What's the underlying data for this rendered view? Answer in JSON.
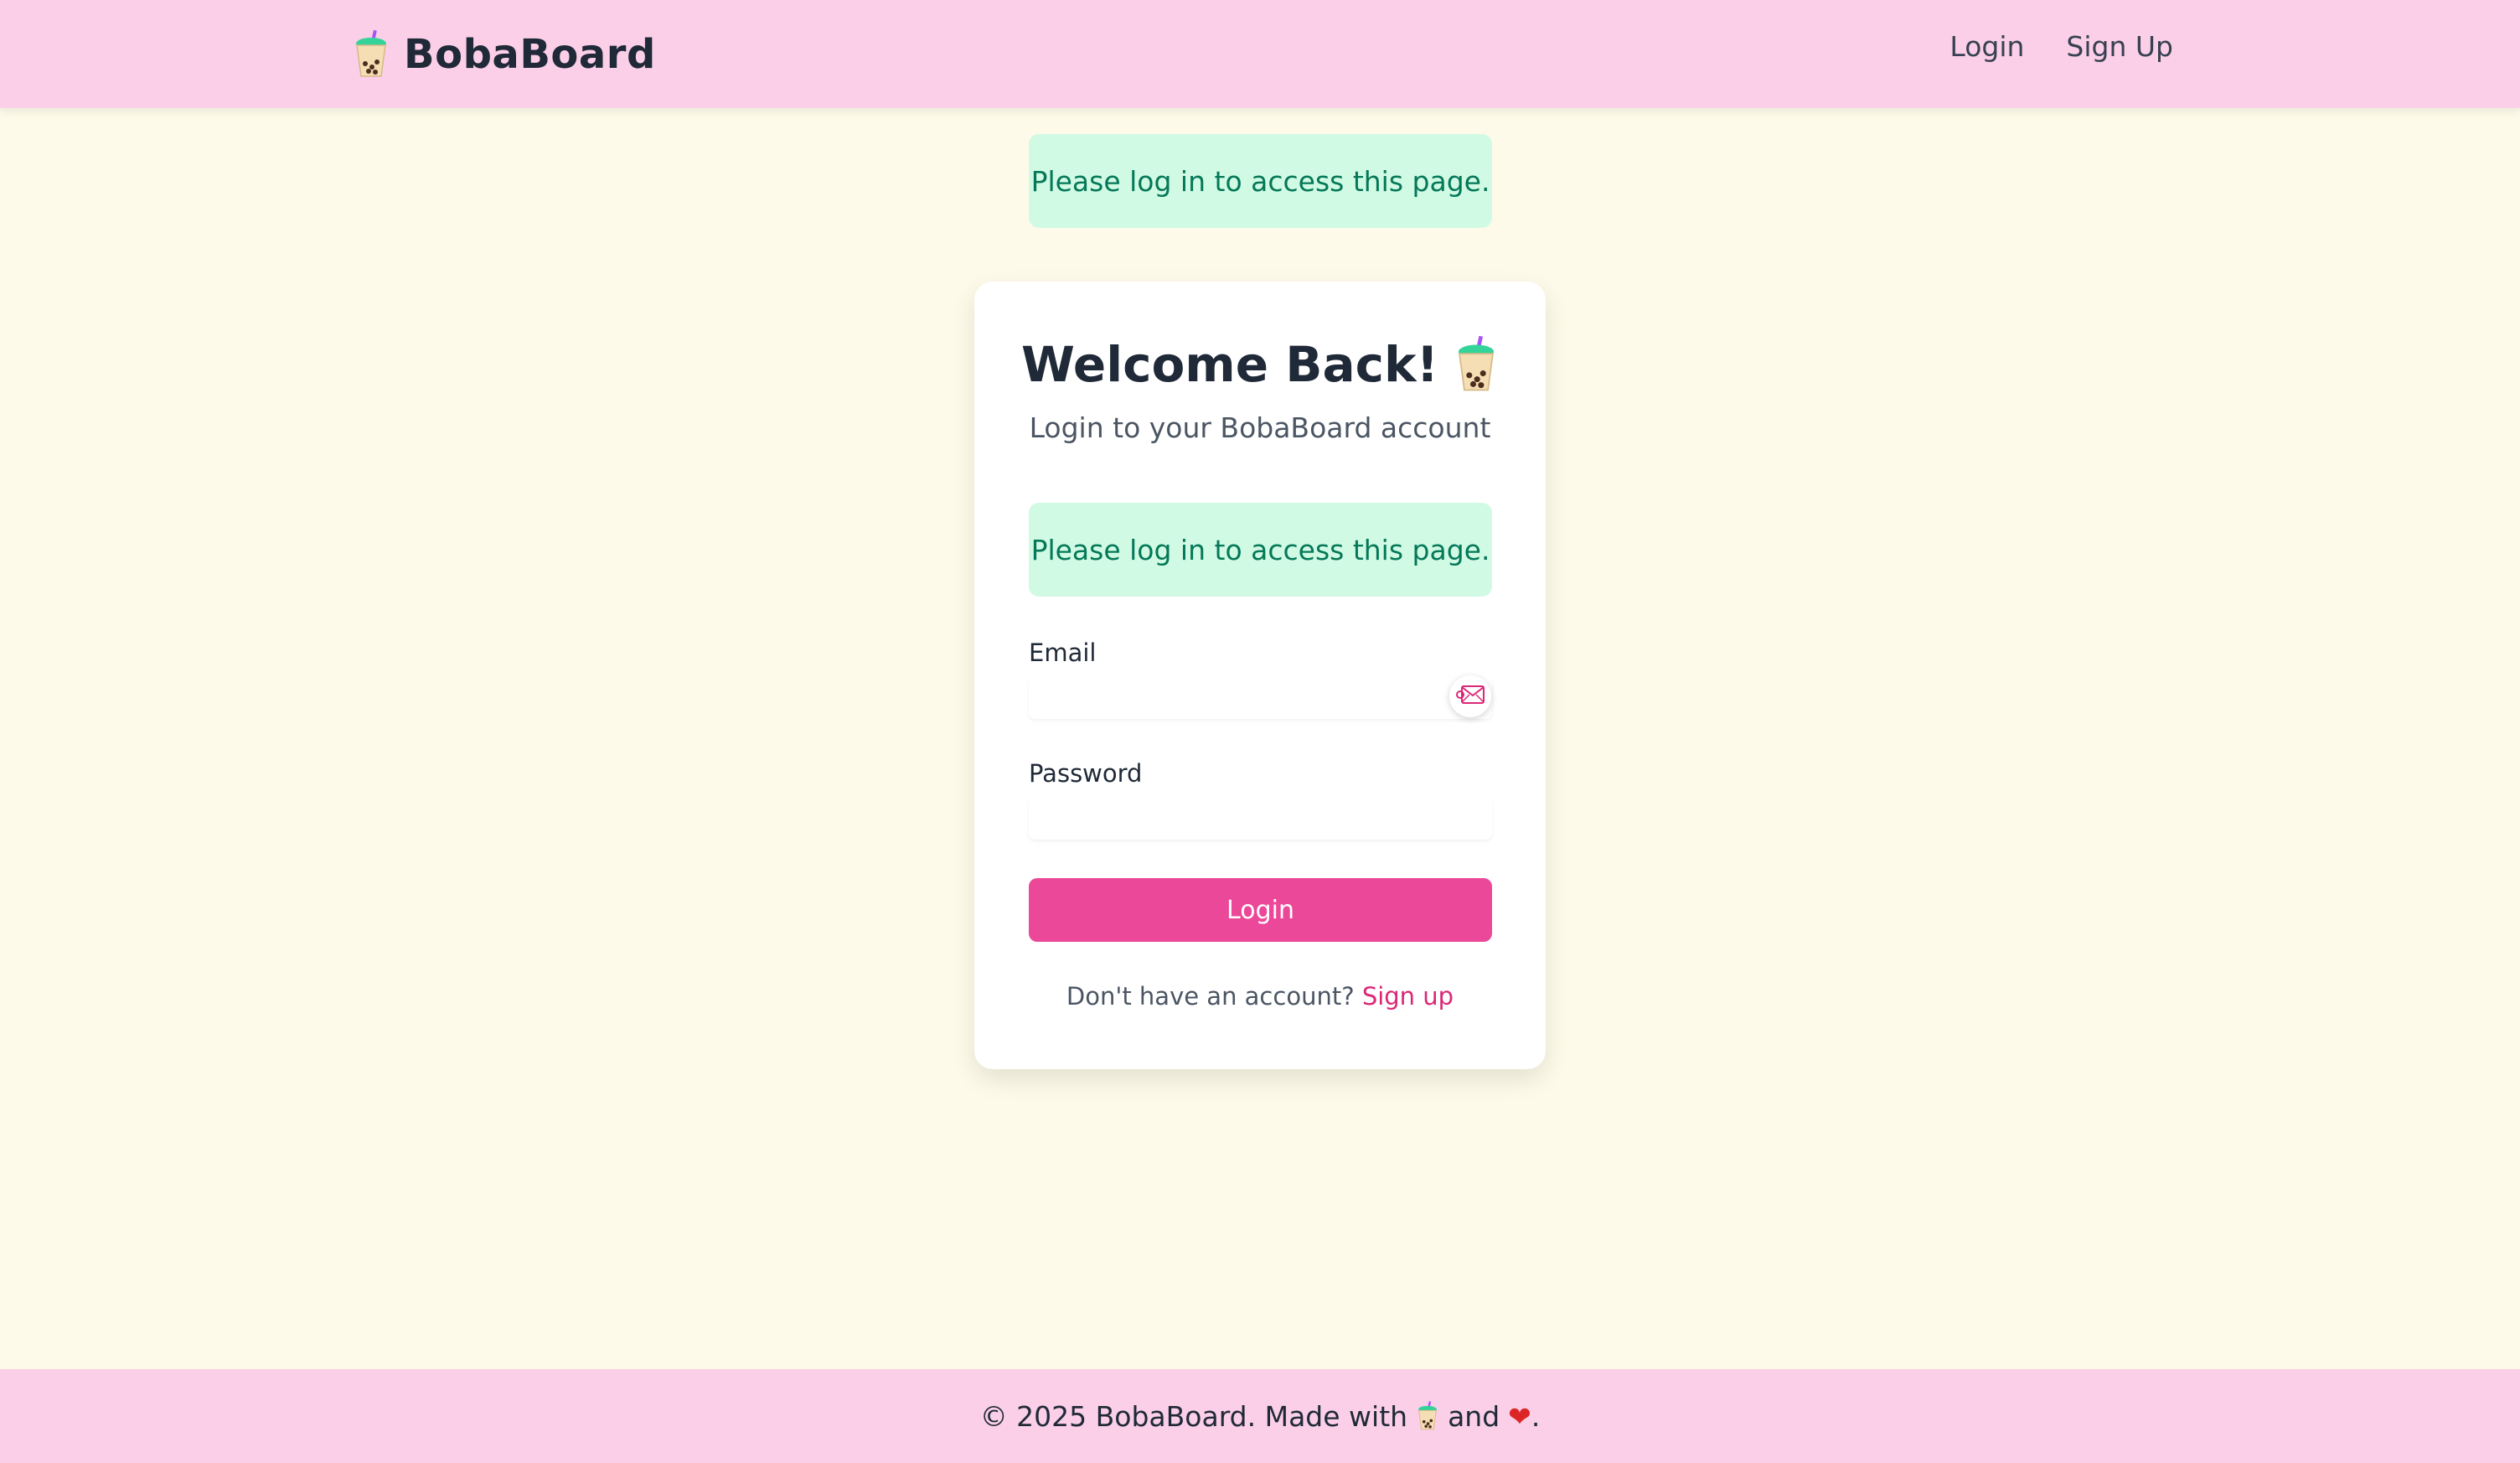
{
  "header": {
    "brand": "BobaBoard",
    "brand_icon": "boba-tea-icon",
    "nav": [
      "Login",
      "Sign Up"
    ]
  },
  "flash_top": "Please log in to access this page.",
  "card": {
    "title": "Welcome Back!",
    "title_icon": "boba-tea-icon",
    "subtitle": "Login to your BobaBoard account",
    "flash": "Please log in to access this page.",
    "email_label": "Email",
    "email_value": "",
    "email_badge_icon": "envelope-icon",
    "password_label": "Password",
    "password_value": "",
    "login_button": "Login",
    "signup_prompt": "Don't have an account?",
    "signup_link": "Sign up"
  },
  "footer": {
    "prefix": "© 2025 BobaBoard. Made with",
    "middle": "and",
    "suffix": ".",
    "boba_icon": "boba-tea-icon",
    "heart": "❤"
  },
  "colors": {
    "header_bg": "#fbcfe8",
    "page_bg": "#fefae9",
    "accent": "#ec4899",
    "link": "#db2777",
    "flash_bg": "#d1fae5",
    "flash_text": "#047857"
  }
}
